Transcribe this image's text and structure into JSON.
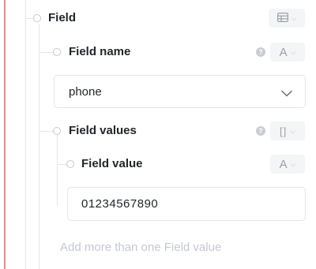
{
  "field": {
    "label": "Field",
    "type_icon": "table-icon"
  },
  "field_name": {
    "label": "Field name",
    "type_icon": "text-A-icon",
    "type_glyph": "A",
    "value": "phone"
  },
  "field_values": {
    "label": "Field values",
    "type_icon": "array-brackets-icon",
    "type_glyph": "[]"
  },
  "field_value": {
    "label": "Field value",
    "type_icon": "text-A-icon",
    "type_glyph": "A",
    "value": "01234567890"
  },
  "add_more": {
    "label": "Add more than one Field value"
  },
  "colors": {
    "required_line": "#e08e8e",
    "tree_line": "#e3e6ea",
    "text": "#22252b",
    "muted": "#c4c9d0"
  }
}
